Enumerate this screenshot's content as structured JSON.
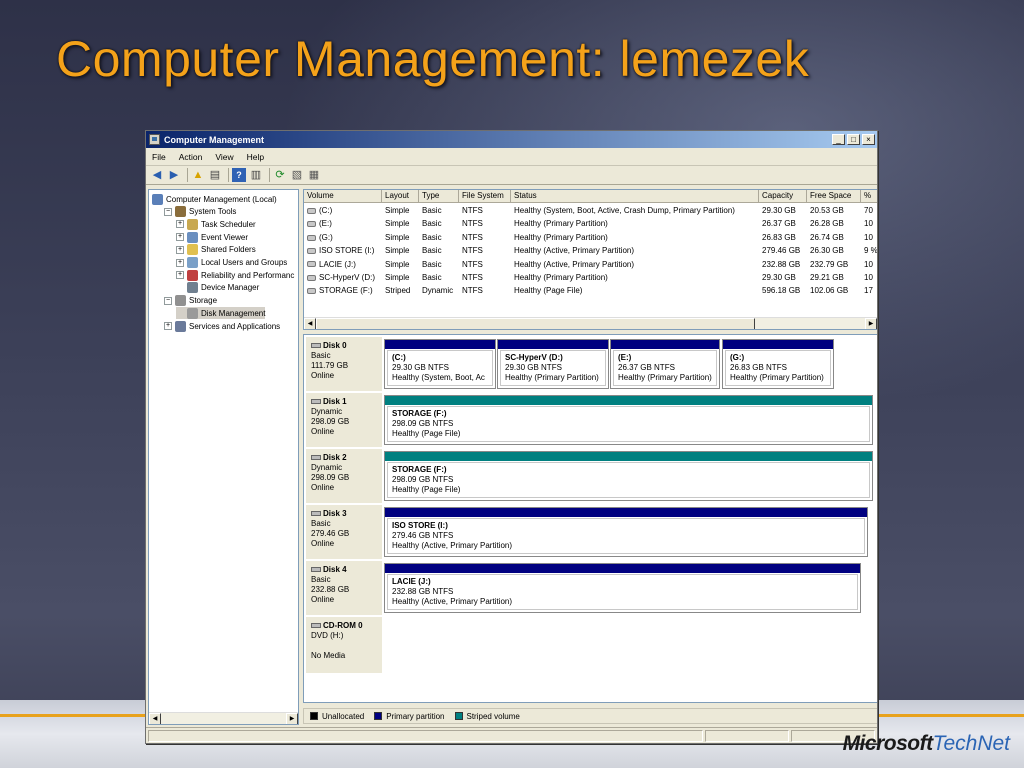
{
  "slide": {
    "title": "Computer Management: lemezek",
    "logo_microsoft": "Microsoft",
    "logo_technet": "TechNet"
  },
  "window": {
    "title": "Computer Management",
    "minimize": "_",
    "maximize": "□",
    "close": "×"
  },
  "menu": [
    {
      "label": "File"
    },
    {
      "label": "Action"
    },
    {
      "label": "View"
    },
    {
      "label": "Help"
    }
  ],
  "toolbar_icons": [
    "back-icon",
    "forward-icon",
    "up-folder-icon",
    "show-hide-tree-icon",
    "help-icon",
    "properties-icon",
    "refresh-icon",
    "export-icon",
    "settings-icon"
  ],
  "tree": [
    {
      "label": "Computer Management (Local)",
      "expander": "",
      "icon": "computer-icon",
      "indent": 0
    },
    {
      "label": "System Tools",
      "expander": "−",
      "icon": "tools-icon",
      "indent": 1
    },
    {
      "label": "Task Scheduler",
      "expander": "+",
      "icon": "clock-icon",
      "indent": 2
    },
    {
      "label": "Event Viewer",
      "expander": "+",
      "icon": "event-icon",
      "indent": 2
    },
    {
      "label": "Shared Folders",
      "expander": "+",
      "icon": "folder-icon",
      "indent": 2
    },
    {
      "label": "Local Users and Groups",
      "expander": "+",
      "icon": "users-icon",
      "indent": 2
    },
    {
      "label": "Reliability and Performanc",
      "expander": "+",
      "icon": "gauge-icon",
      "indent": 2
    },
    {
      "label": "Device Manager",
      "expander": "",
      "icon": "device-icon",
      "indent": 2
    },
    {
      "label": "Storage",
      "expander": "−",
      "icon": "storage-icon",
      "indent": 1
    },
    {
      "label": "Disk Management",
      "expander": "",
      "icon": "disk-icon",
      "indent": 2,
      "selected": true
    },
    {
      "label": "Services and Applications",
      "expander": "+",
      "icon": "services-icon",
      "indent": 1
    }
  ],
  "list": {
    "columns": [
      "Volume",
      "Layout",
      "Type",
      "File System",
      "Status",
      "Capacity",
      "Free Space",
      "%"
    ],
    "rows": [
      [
        "(C:)",
        "Simple",
        "Basic",
        "NTFS",
        "Healthy (System, Boot, Active, Crash Dump, Primary Partition)",
        "29.30 GB",
        "20.53 GB",
        "70"
      ],
      [
        "(E:)",
        "Simple",
        "Basic",
        "NTFS",
        "Healthy (Primary Partition)",
        "26.37 GB",
        "26.28 GB",
        "10"
      ],
      [
        "(G:)",
        "Simple",
        "Basic",
        "NTFS",
        "Healthy (Primary Partition)",
        "26.83 GB",
        "26.74 GB",
        "10"
      ],
      [
        "ISO STORE (I:)",
        "Simple",
        "Basic",
        "NTFS",
        "Healthy (Active, Primary Partition)",
        "279.46 GB",
        "26.30 GB",
        "9 %"
      ],
      [
        "LACIE (J:)",
        "Simple",
        "Basic",
        "NTFS",
        "Healthy (Active, Primary Partition)",
        "232.88 GB",
        "232.79 GB",
        "10"
      ],
      [
        "SC-HyperV (D:)",
        "Simple",
        "Basic",
        "NTFS",
        "Healthy (Primary Partition)",
        "29.30 GB",
        "29.21 GB",
        "10"
      ],
      [
        "STORAGE (F:)",
        "Striped",
        "Dynamic",
        "NTFS",
        "Healthy (Page File)",
        "596.18 GB",
        "102.06 GB",
        "17"
      ]
    ]
  },
  "disks": [
    {
      "name": "Disk 0",
      "type": "Basic",
      "size": "111.79 GB",
      "status": "Online",
      "partitions": [
        {
          "title": "(C:)",
          "size": "29.30 GB NTFS",
          "status": "Healthy (System, Boot, Ac",
          "kind": "primary"
        },
        {
          "title": "SC-HyperV  (D:)",
          "size": "29.30 GB NTFS",
          "status": "Healthy (Primary Partition)",
          "kind": "primary"
        },
        {
          "title": "(E:)",
          "size": "26.37 GB NTFS",
          "status": "Healthy (Primary Partition)",
          "kind": "primary"
        },
        {
          "title": "(G:)",
          "size": "26.83 GB NTFS",
          "status": "Healthy (Primary Partition)",
          "kind": "primary"
        }
      ]
    },
    {
      "name": "Disk 1",
      "type": "Dynamic",
      "size": "298.09 GB",
      "status": "Online",
      "partitions": [
        {
          "title": "STORAGE  (F:)",
          "size": "298.09 GB NTFS",
          "status": "Healthy (Page File)",
          "kind": "striped"
        }
      ]
    },
    {
      "name": "Disk 2",
      "type": "Dynamic",
      "size": "298.09 GB",
      "status": "Online",
      "partitions": [
        {
          "title": "STORAGE  (F:)",
          "size": "298.09 GB NTFS",
          "status": "Healthy (Page File)",
          "kind": "striped"
        }
      ]
    },
    {
      "name": "Disk 3",
      "type": "Basic",
      "size": "279.46 GB",
      "status": "Online",
      "partitions": [
        {
          "title": "ISO STORE  (I:)",
          "size": "279.46 GB NTFS",
          "status": "Healthy (Active, Primary Partition)",
          "kind": "primary"
        }
      ]
    },
    {
      "name": "Disk 4",
      "type": "Basic",
      "size": "232.88 GB",
      "status": "Online",
      "partitions": [
        {
          "title": "LACIE  (J:)",
          "size": "232.88 GB NTFS",
          "status": "Healthy (Active, Primary Partition)",
          "kind": "primary"
        }
      ]
    },
    {
      "name": "CD-ROM 0",
      "type": "DVD (H:)",
      "size": "",
      "status": "No Media",
      "partitions": []
    }
  ],
  "legend": [
    {
      "label": "Unallocated",
      "color": "#000000"
    },
    {
      "label": "Primary partition",
      "color": "#000080"
    },
    {
      "label": "Striped volume",
      "color": "#008080"
    }
  ],
  "colors": {
    "primary": "#000080",
    "striped": "#008080",
    "accent": "#f4a21a"
  }
}
